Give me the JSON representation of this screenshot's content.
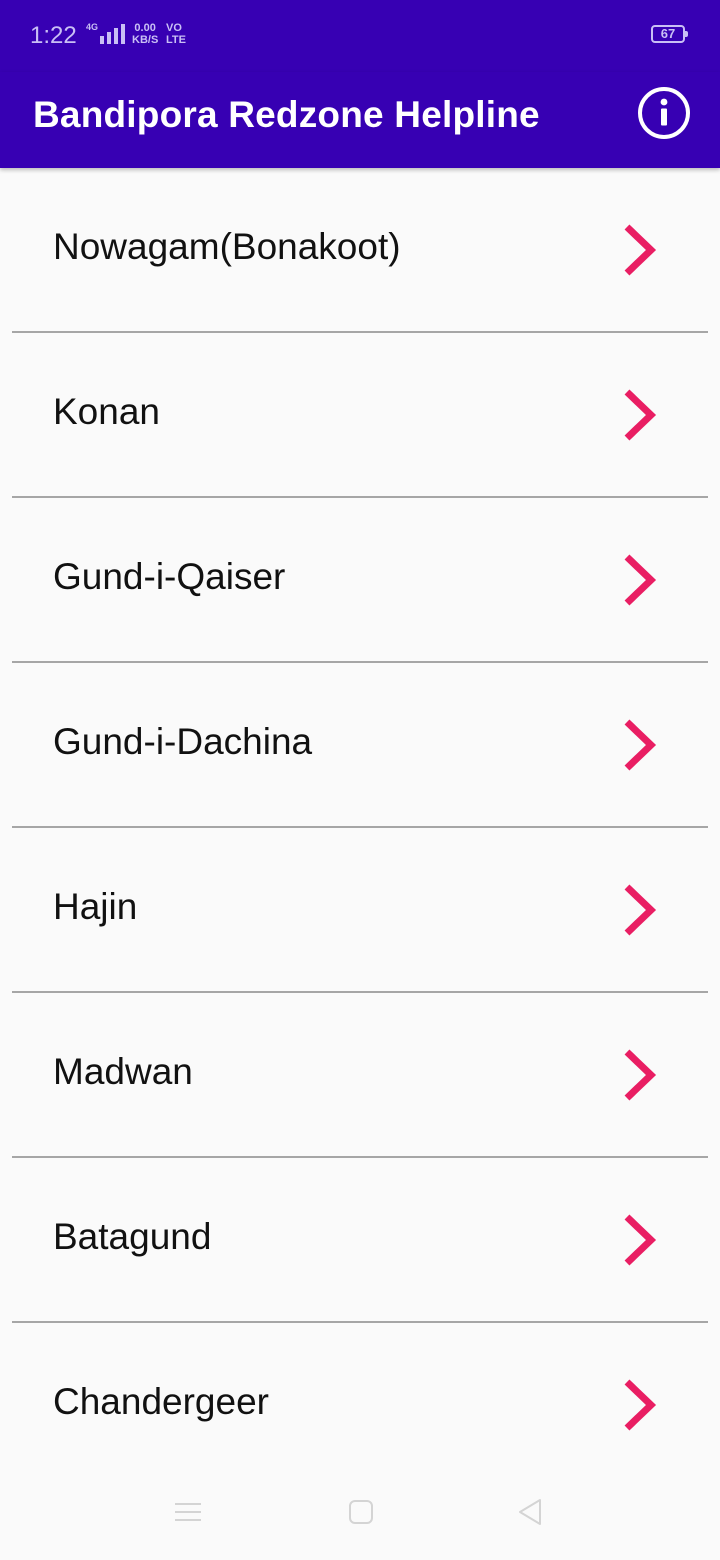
{
  "status_bar": {
    "time": "1:22",
    "network": "4G",
    "speed_value": "0.00",
    "speed_unit": "KB/S",
    "volte_top": "VO",
    "volte_bottom": "LTE",
    "battery": "67"
  },
  "app_bar": {
    "title": "Bandipora Redzone Helpline",
    "info_icon": "info-icon"
  },
  "list": {
    "items": [
      {
        "label": "Nowagam(Bonakoot)"
      },
      {
        "label": "Konan"
      },
      {
        "label": "Gund-i-Qaiser"
      },
      {
        "label": "Gund-i-Dachina"
      },
      {
        "label": "Hajin"
      },
      {
        "label": "Madwan"
      },
      {
        "label": "Batagund"
      },
      {
        "label": "Chandergeer"
      }
    ],
    "chevron_icon": "chevron-right-icon"
  },
  "colors": {
    "primary": "#3700b3",
    "accent": "#e91e63",
    "background": "#fafafa"
  },
  "nav_bar": {
    "menu_icon": "menu-icon",
    "home_icon": "home-icon",
    "back_icon": "back-icon"
  }
}
